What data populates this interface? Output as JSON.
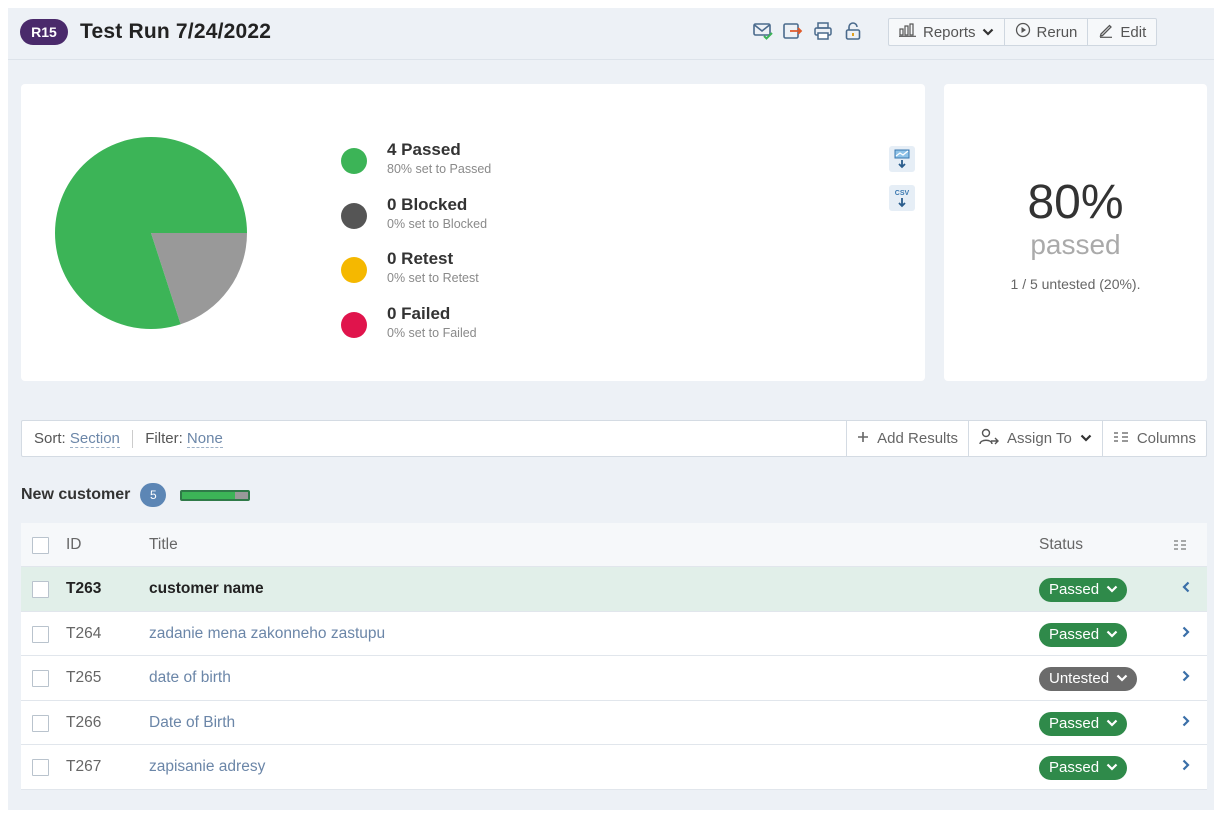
{
  "header": {
    "run_badge": "R15",
    "title": "Test Run 7/24/2022",
    "icons": [
      "email-check-icon",
      "export-icon",
      "print-icon",
      "unlock-icon"
    ],
    "buttons": {
      "reports": "Reports",
      "rerun": "Rerun",
      "edit": "Edit"
    }
  },
  "stats": {
    "legend": [
      {
        "label": "4 Passed",
        "sub": "80% set to Passed",
        "color": "#3cb457"
      },
      {
        "label": "0 Blocked",
        "sub": "0% set to Blocked",
        "color": "#555555"
      },
      {
        "label": "0 Retest",
        "sub": "0% set to Retest",
        "color": "#f5b800"
      },
      {
        "label": "0 Failed",
        "sub": "0% set to Failed",
        "color": "#e0144c"
      }
    ],
    "pie": [
      {
        "name": "Passed",
        "value": 4,
        "color": "#3cb457"
      },
      {
        "name": "Untested",
        "value": 1,
        "color": "#999999"
      }
    ],
    "export_chart_icon": "chart-export-icon",
    "export_csv_label": "CSV",
    "percent": "80%",
    "percent_word": "passed",
    "untested_text": "1 / 5 untested (20%)."
  },
  "toolbar": {
    "sort_label": "Sort:",
    "sort_value": "Section",
    "filter_label": "Filter:",
    "filter_value": "None",
    "add_results": "Add Results",
    "assign_to": "Assign To",
    "columns": "Columns"
  },
  "section": {
    "title": "New customer",
    "count": "5",
    "progress_passed_fraction": 0.8
  },
  "table": {
    "headers": {
      "id": "ID",
      "title": "Title",
      "status": "Status"
    },
    "rows": [
      {
        "id": "T263",
        "title": "customer name",
        "status": "Passed",
        "status_color": "#2f8a4a",
        "selected": true
      },
      {
        "id": "T264",
        "title": "zadanie mena zakonneho zastupu",
        "status": "Passed",
        "status_color": "#2f8a4a",
        "selected": false
      },
      {
        "id": "T265",
        "title": "date of birth",
        "status": "Untested",
        "status_color": "#6b6b6b",
        "selected": false
      },
      {
        "id": "T266",
        "title": "Date of Birth",
        "status": "Passed",
        "status_color": "#2f8a4a",
        "selected": false
      },
      {
        "id": "T267",
        "title": "zapisanie adresy",
        "status": "Passed",
        "status_color": "#2f8a4a",
        "selected": false
      }
    ]
  }
}
